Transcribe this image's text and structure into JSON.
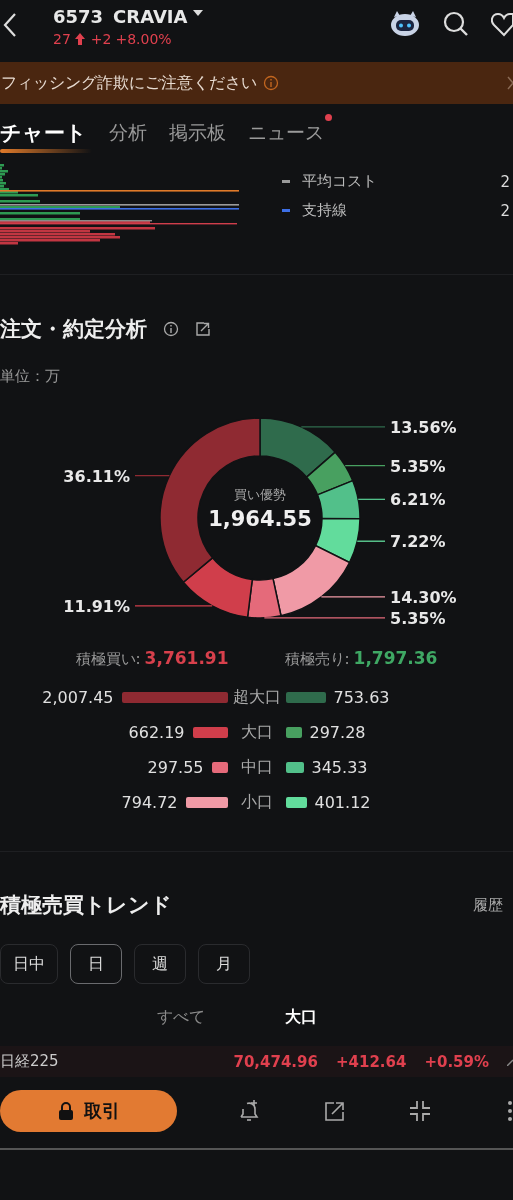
{
  "header": {
    "code": "6573",
    "name": "CRAVIA",
    "price": "27",
    "change": "+2",
    "change_pct": "+8.00%"
  },
  "banner": {
    "text": "フィッシング詐欺にご注意ください"
  },
  "tabs": [
    {
      "label": "チャート",
      "selected": true,
      "dot": false
    },
    {
      "label": "分析",
      "selected": false,
      "dot": false
    },
    {
      "label": "掲示板",
      "selected": false,
      "dot": false
    },
    {
      "label": "ニュース",
      "selected": false,
      "dot": true
    }
  ],
  "chart_legend": [
    {
      "label": "平均コスト",
      "value": "2",
      "color": "#9a9a9a"
    },
    {
      "label": "支持線",
      "value": "2",
      "color": "#3d6fe6"
    }
  ],
  "order_analysis": {
    "title": "注文・約定分析",
    "unit": "単位：万",
    "center_label": "買い優勢",
    "center_value": "1,964.55",
    "chart_data": {
      "type": "donut",
      "values": [
        13.56,
        5.35,
        6.21,
        7.22,
        14.3,
        5.35,
        11.91,
        36.11
      ],
      "data_labels": true,
      "value_labels": [
        "13.56%",
        "5.35%",
        "6.21%",
        "7.22%",
        "14.30%",
        "5.35%",
        "11.91%",
        "36.11%"
      ]
    },
    "buy_total_label": "積極買い:",
    "buy_total": "3,761.91",
    "sell_total_label": "積極売り:",
    "sell_total": "1,797.36",
    "breakdown": [
      {
        "label": "超大口",
        "buy": {
          "value": "2,007.45",
          "color": "#8f2a32"
        },
        "sell": {
          "value": "753.63",
          "color": "#2f6b4c"
        }
      },
      {
        "label": "大口",
        "buy": {
          "value": "662.19",
          "color": "#d03e4b"
        },
        "sell": {
          "value": "297.28",
          "color": "#48a060"
        }
      },
      {
        "label": "中口",
        "buy": {
          "value": "297.55",
          "color": "#e56a7a"
        },
        "sell": {
          "value": "345.33",
          "color": "#52c08a"
        }
      },
      {
        "label": "小口",
        "buy": {
          "value": "794.72",
          "color": "#f09aa6"
        },
        "sell": {
          "value": "401.12",
          "color": "#62dc9c"
        }
      }
    ]
  },
  "trend": {
    "title": "積極売買トレンド",
    "history_link": "履歴",
    "periods": [
      {
        "label": "日中",
        "selected": false
      },
      {
        "label": "日",
        "selected": true
      },
      {
        "label": "週",
        "selected": false
      },
      {
        "label": "月",
        "selected": false
      }
    ],
    "subtabs": [
      {
        "label": "すべて",
        "selected": false
      },
      {
        "label": "大口",
        "selected": true
      }
    ]
  },
  "index_bar": {
    "name": "日経225",
    "value": "70,474.96",
    "change": "+412.64",
    "change_pct": "+0.59%"
  },
  "toolbar": {
    "trade_button": "取引"
  }
}
